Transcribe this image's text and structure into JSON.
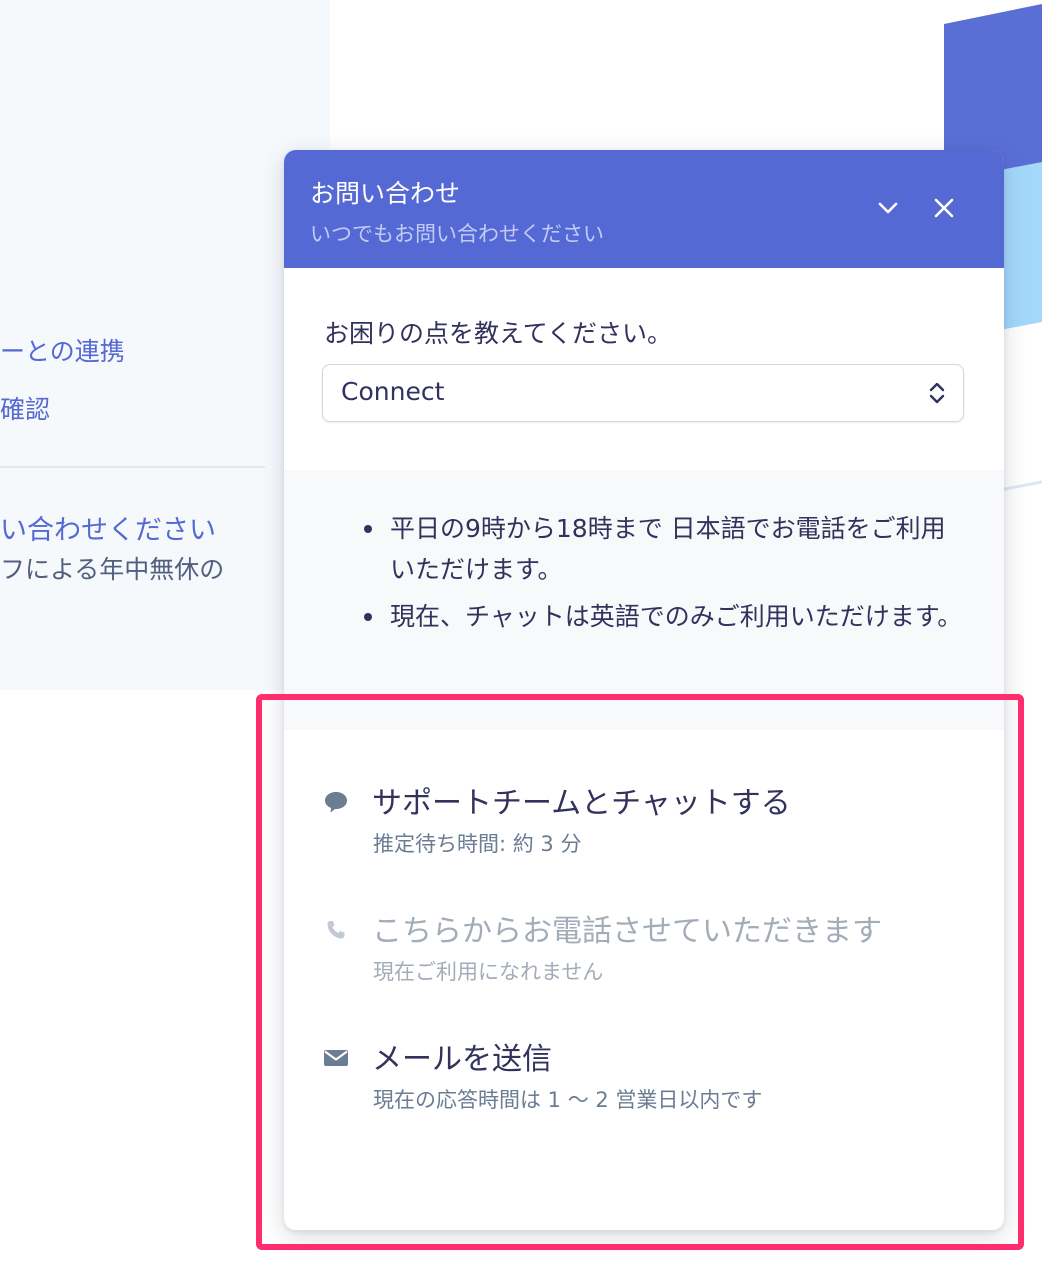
{
  "background": {
    "links": [
      "ーとの連携",
      "確認"
    ],
    "contact_title": "い合わせください",
    "contact_desc": "フによる年中無休の"
  },
  "widget": {
    "title": "お問い合わせ",
    "subtitle": "いつでもお問い合わせください",
    "collapse_icon": "chevron-down-icon",
    "close_icon": "close-icon",
    "question": "お困りの点を教えてください。",
    "select_value": "Connect",
    "notes": [
      "平日の9時から18時まで 日本語でお電話をご利用いただけます。",
      "現在、チャットは英語でのみご利用いただけます。"
    ],
    "options": [
      {
        "icon": "chat-bubble-icon",
        "title": "サポートチームとチャットする",
        "subtitle": "推定待ち時間: 約 3 分",
        "enabled": true
      },
      {
        "icon": "phone-icon",
        "title": "こちらからお電話させていただきます",
        "subtitle": "現在ご利用になれません",
        "enabled": false
      },
      {
        "icon": "mail-icon",
        "title": "メールを送信",
        "subtitle": "現在の応答時間は 1 〜 2 営業日以内です",
        "enabled": true
      }
    ]
  },
  "colors": {
    "header": "#5469d4",
    "highlight": "#ff2d6e",
    "text": "#32325d",
    "muted": "#a3acb9"
  }
}
